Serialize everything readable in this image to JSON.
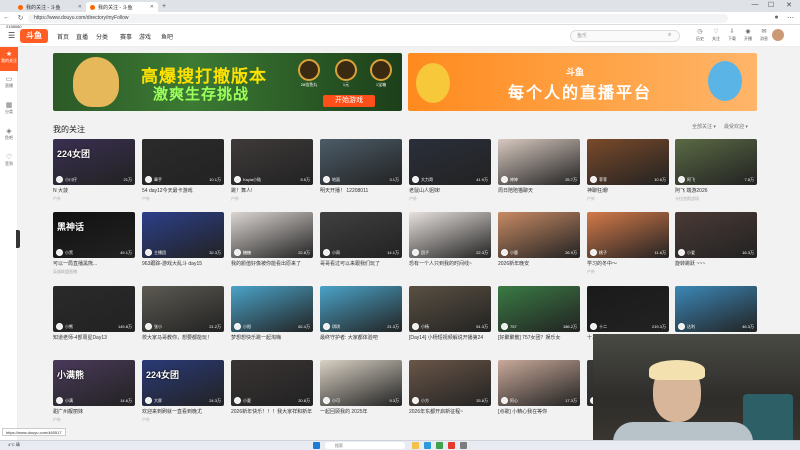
{
  "browser": {
    "tabs": [
      {
        "title": "我的关注 - 斗鱼"
      },
      {
        "title": "我的关注 - 斗鱼"
      }
    ],
    "new_tab": "+",
    "window_controls": [
      "—",
      "☐",
      "✕"
    ],
    "url": "https://www.douyu.com/directory/myFollow"
  },
  "header": {
    "channel_number": "2158080",
    "logo": "斗鱼",
    "nav": [
      "首页",
      "直播",
      "分类",
      "赛事",
      "游戏",
      "鱼吧"
    ],
    "search_placeholder": "鱼乐",
    "icons": [
      {
        "label": "历史",
        "icon": "clock-icon"
      },
      {
        "label": "关注",
        "icon": "heart-icon"
      },
      {
        "label": "下载",
        "icon": "download-icon"
      },
      {
        "label": "开播",
        "icon": "camera-icon"
      },
      {
        "label": "消息",
        "icon": "message-icon"
      },
      {
        "label": "任务",
        "icon": "task-icon"
      },
      {
        "label": "充值",
        "icon": "gift-icon"
      }
    ]
  },
  "sidebar": {
    "items": [
      {
        "label": "我的关注",
        "icon": "star-icon"
      },
      {
        "label": "直播",
        "icon": "tv-icon"
      },
      {
        "label": "分类",
        "icon": "grid-icon"
      },
      {
        "label": "鱼吧",
        "icon": "fish-icon"
      },
      {
        "label": "签到",
        "icon": "heart-icon"
      }
    ]
  },
  "banners": {
    "game": {
      "line1": "高爆搜打撤版本",
      "line2": "激爽生存挑战",
      "button": "开始游戏",
      "coins": [
        "28倍鱼丸",
        "1元",
        "1宝箱"
      ]
    },
    "platform": {
      "logo": "斗鱼",
      "slogan": "每个人的直播平台"
    }
  },
  "section": {
    "title": "我的关注",
    "sort1": "全部关注 ▾",
    "sort2": "最受欢迎 ▾"
  },
  "cards": [
    {
      "title": "N 大菠",
      "tag": "户外",
      "streamer": "小川仔",
      "hot": "21万",
      "overlay": "224女团",
      "color": "#3a2f52"
    },
    {
      "title": "54 day12今天最卡游戏",
      "tag": "户外",
      "streamer": "章手",
      "hot": "10.1万",
      "overlay": "",
      "color": "#2b2b2b"
    },
    {
      "title": "跳！舞人!",
      "tag": "户外",
      "streamer": "Kayla小陆",
      "hot": "5.5万",
      "overlay": "",
      "color": "#3f3a3a"
    },
    {
      "title": "明天开播！ 12208011",
      "tag": "",
      "streamer": "地面",
      "hot": "3.1万",
      "overlay": "",
      "color": "#4c5c68"
    },
    {
      "title": "老鼠山人姐妹!",
      "tag": "户外",
      "streamer": "大力哥",
      "hot": "41.9万",
      "overlay": "",
      "color": "#2a2f3a"
    },
    {
      "title": "周日陪陪猫聊天",
      "tag": "",
      "streamer": "婷婷",
      "hot": "25.7万",
      "overlay": "",
      "color": "#d8c9c0"
    },
    {
      "title": "神聊狂潮!",
      "tag": "户外",
      "streamer": "菲菲",
      "hot": "10.6万",
      "overlay": "",
      "color": "#7a4a2a"
    },
    {
      "title": "阿飞 端游2026",
      "tag": "卡拉克斯战场",
      "streamer": "阿飞",
      "hot": "7.8万",
      "overlay": "",
      "color": "#5a6a44"
    },
    {
      "title": "可以一局直播黑熊...",
      "tag": "英雄联盟直播",
      "streamer": "小黑",
      "hot": "49.1万",
      "overlay": "黑神话",
      "color": "#111111"
    },
    {
      "title": "963跟踪-游戏大乱斗 day15",
      "tag": "",
      "streamer": "主播团",
      "hot": "32.3万",
      "overlay": "",
      "color": "#2c3f8a"
    },
    {
      "title": "我的颜值好像被你能看出原来了",
      "tag": "",
      "streamer": "糖糖",
      "hot": "22.8万",
      "overlay": "",
      "color": "#dcd6d2"
    },
    {
      "title": "哥哥看过可以来跟我们玩了",
      "tag": "",
      "streamer": "小雨",
      "hot": "14.1万",
      "overlay": "",
      "color": "#404040"
    },
    {
      "title": "恐有一个人只到我的时间线~",
      "tag": "",
      "streamer": "团子",
      "hot": "22.3万",
      "overlay": "",
      "color": "#e8e2de"
    },
    {
      "title": "2026新年晚安",
      "tag": "",
      "streamer": "小鹿",
      "hot": "26.9万",
      "overlay": "",
      "color": "#c78a64"
    },
    {
      "title": "学习的冬中～",
      "tag": "户外",
      "streamer": "桃子",
      "hot": "11.6万",
      "overlay": "",
      "color": "#d47a4a"
    },
    {
      "title": "旋转跳跃 ~~~",
      "tag": "",
      "streamer": "小爱",
      "hot": "16.3万",
      "overlay": "",
      "color": "#4a3a36"
    },
    {
      "title": "知道老师-4部周星Day13",
      "tag": "",
      "streamer": "小熊",
      "hot": "149.8万",
      "overlay": "",
      "color": "#2a2a2a"
    },
    {
      "title": "校大家马哥教你，想要都能玩！",
      "tag": "",
      "streamer": "张小",
      "hot": "21.2万",
      "overlay": "",
      "color": "#5c5a52"
    },
    {
      "title": "梦想想快乐跳一起淘嗨",
      "tag": "",
      "streamer": "小阳",
      "hot": "62.4万",
      "overlay": "",
      "color": "#4aa3c8"
    },
    {
      "title": "最终守护者: 大家都体验吧",
      "tag": "",
      "streamer": "琪琪",
      "hot": "21.3万",
      "overlay": "",
      "color": "#4aa3c8"
    },
    {
      "title": "[Day14] 小杨短视频解说开播第24",
      "tag": "",
      "streamer": "小杨",
      "hot": "51.3万",
      "overlay": "",
      "color": "#5a5042"
    },
    {
      "title": "[好聚聚散] 757女团？娱乐女",
      "tag": "",
      "streamer": "757",
      "hot": "186.2万",
      "overlay": "",
      "color": "#3a7a44"
    },
    {
      "title": "十二时辰开播",
      "tag": "",
      "streamer": "十二",
      "hot": "219.3万",
      "overlay": "",
      "color": "#1a1a1a"
    },
    {
      "title": "奥运跟看达利的乐淘篮球",
      "tag": "户外",
      "streamer": "达利",
      "hot": "46.3万",
      "overlay": "",
      "color": "#3c88b8"
    },
    {
      "title": "甜广州靓丽妹",
      "tag": "户外",
      "streamer": "小满",
      "hot": "14.6万",
      "overlay": "小满熊",
      "color": "#4a3a5a"
    },
    {
      "title": "欢迎来到刷就一直看到晚尤",
      "tag": "户外",
      "streamer": "大胖",
      "hot": "24.3万",
      "overlay": "224女团",
      "color": "#2a3a78"
    },
    {
      "title": "2026新年快乐！！！我大家祥和新年",
      "tag": "",
      "streamer": "小夏",
      "hot": "20.8万",
      "overlay": "",
      "color": "#3a3434"
    },
    {
      "title": "一起回顾我的 2025年",
      "tag": "",
      "streamer": "小可",
      "hot": "9.3万",
      "overlay": "",
      "color": "#d9d1c4"
    },
    {
      "title": "2026年东都开启新征程~",
      "tag": "",
      "streamer": "小方",
      "hot": "33.8万",
      "overlay": "",
      "color": "#6a5648"
    },
    {
      "title": "[点歌] 小精心我在等你",
      "tag": "",
      "streamer": "阿心",
      "hot": "17.3万",
      "overlay": "",
      "color": "#c9a99a"
    },
    {
      "title": "",
      "tag": "",
      "streamer": "",
      "hot": "",
      "overlay": "",
      "color": "#3a3a3a"
    },
    {
      "title": "",
      "tag": "",
      "streamer": "",
      "hot": "",
      "overlay": "",
      "color": "#3a3a3a"
    }
  ],
  "status_url": "https://www.douyu.com/460517",
  "taskbar": {
    "weather": "4°C 晴",
    "search": "搜索",
    "icons": [
      "windows-icon",
      "search-icon",
      "folder-icon",
      "edge-icon",
      "chrome-icon",
      "wps-icon",
      "settings-icon"
    ]
  },
  "colors": {
    "accent": "#ff5d23"
  }
}
